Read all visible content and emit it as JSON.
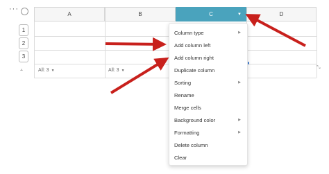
{
  "toolbar": {
    "more_glyph": "···"
  },
  "columns": [
    {
      "label": "A",
      "selected": false
    },
    {
      "label": "B",
      "selected": false
    },
    {
      "label": "C",
      "selected": true
    },
    {
      "label": "D",
      "selected": false
    }
  ],
  "rows": [
    "1",
    "2",
    "3"
  ],
  "filters": [
    {
      "label": "All: 3"
    },
    {
      "label": "All: 3"
    }
  ],
  "context_menu": {
    "items": [
      {
        "label": "Column type",
        "submenu": true
      },
      {
        "label": "Add column left",
        "submenu": false
      },
      {
        "label": "Add column right",
        "submenu": false
      },
      {
        "label": "Duplicate column",
        "submenu": false
      },
      {
        "label": "Sorting",
        "submenu": true
      },
      {
        "label": "Rename",
        "submenu": false
      },
      {
        "label": "Merge cells",
        "submenu": false
      },
      {
        "label": "Background color",
        "submenu": true
      },
      {
        "label": "Formatting",
        "submenu": true
      },
      {
        "label": "Delete column",
        "submenu": false
      },
      {
        "label": "Clear",
        "submenu": false
      }
    ]
  },
  "colors": {
    "selected_header": "#4aa3bd",
    "annotation_arrow": "#c8201c"
  },
  "icons": {
    "submenu": "chevron-right-icon",
    "dropdown": "caret-down-icon"
  }
}
